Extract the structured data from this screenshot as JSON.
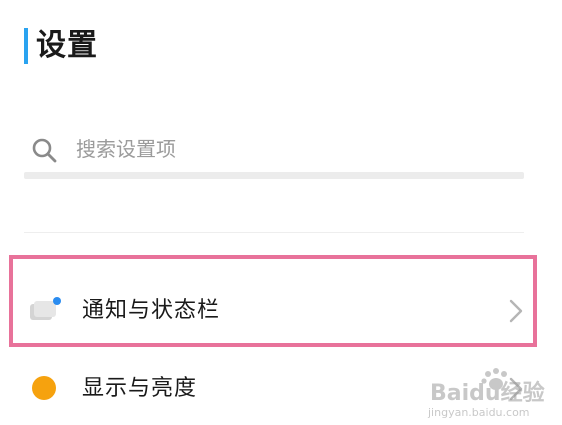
{
  "header": {
    "title": "设置"
  },
  "search": {
    "placeholder": "搜索设置项"
  },
  "settings_items": [
    {
      "label": "通知与状态栏",
      "icon": "notification-statusbar-icon"
    },
    {
      "label": "显示与亮度",
      "icon": "display-brightness-icon"
    }
  ],
  "colors": {
    "accent_bar": "#2aa3f0",
    "highlight_border": "#e8729a",
    "display_icon": "#f6a20e",
    "notification_dot": "#2a8cf0"
  },
  "watermark": {
    "text": "Baidu经验",
    "subtext": "jingyan.baidu.com"
  }
}
